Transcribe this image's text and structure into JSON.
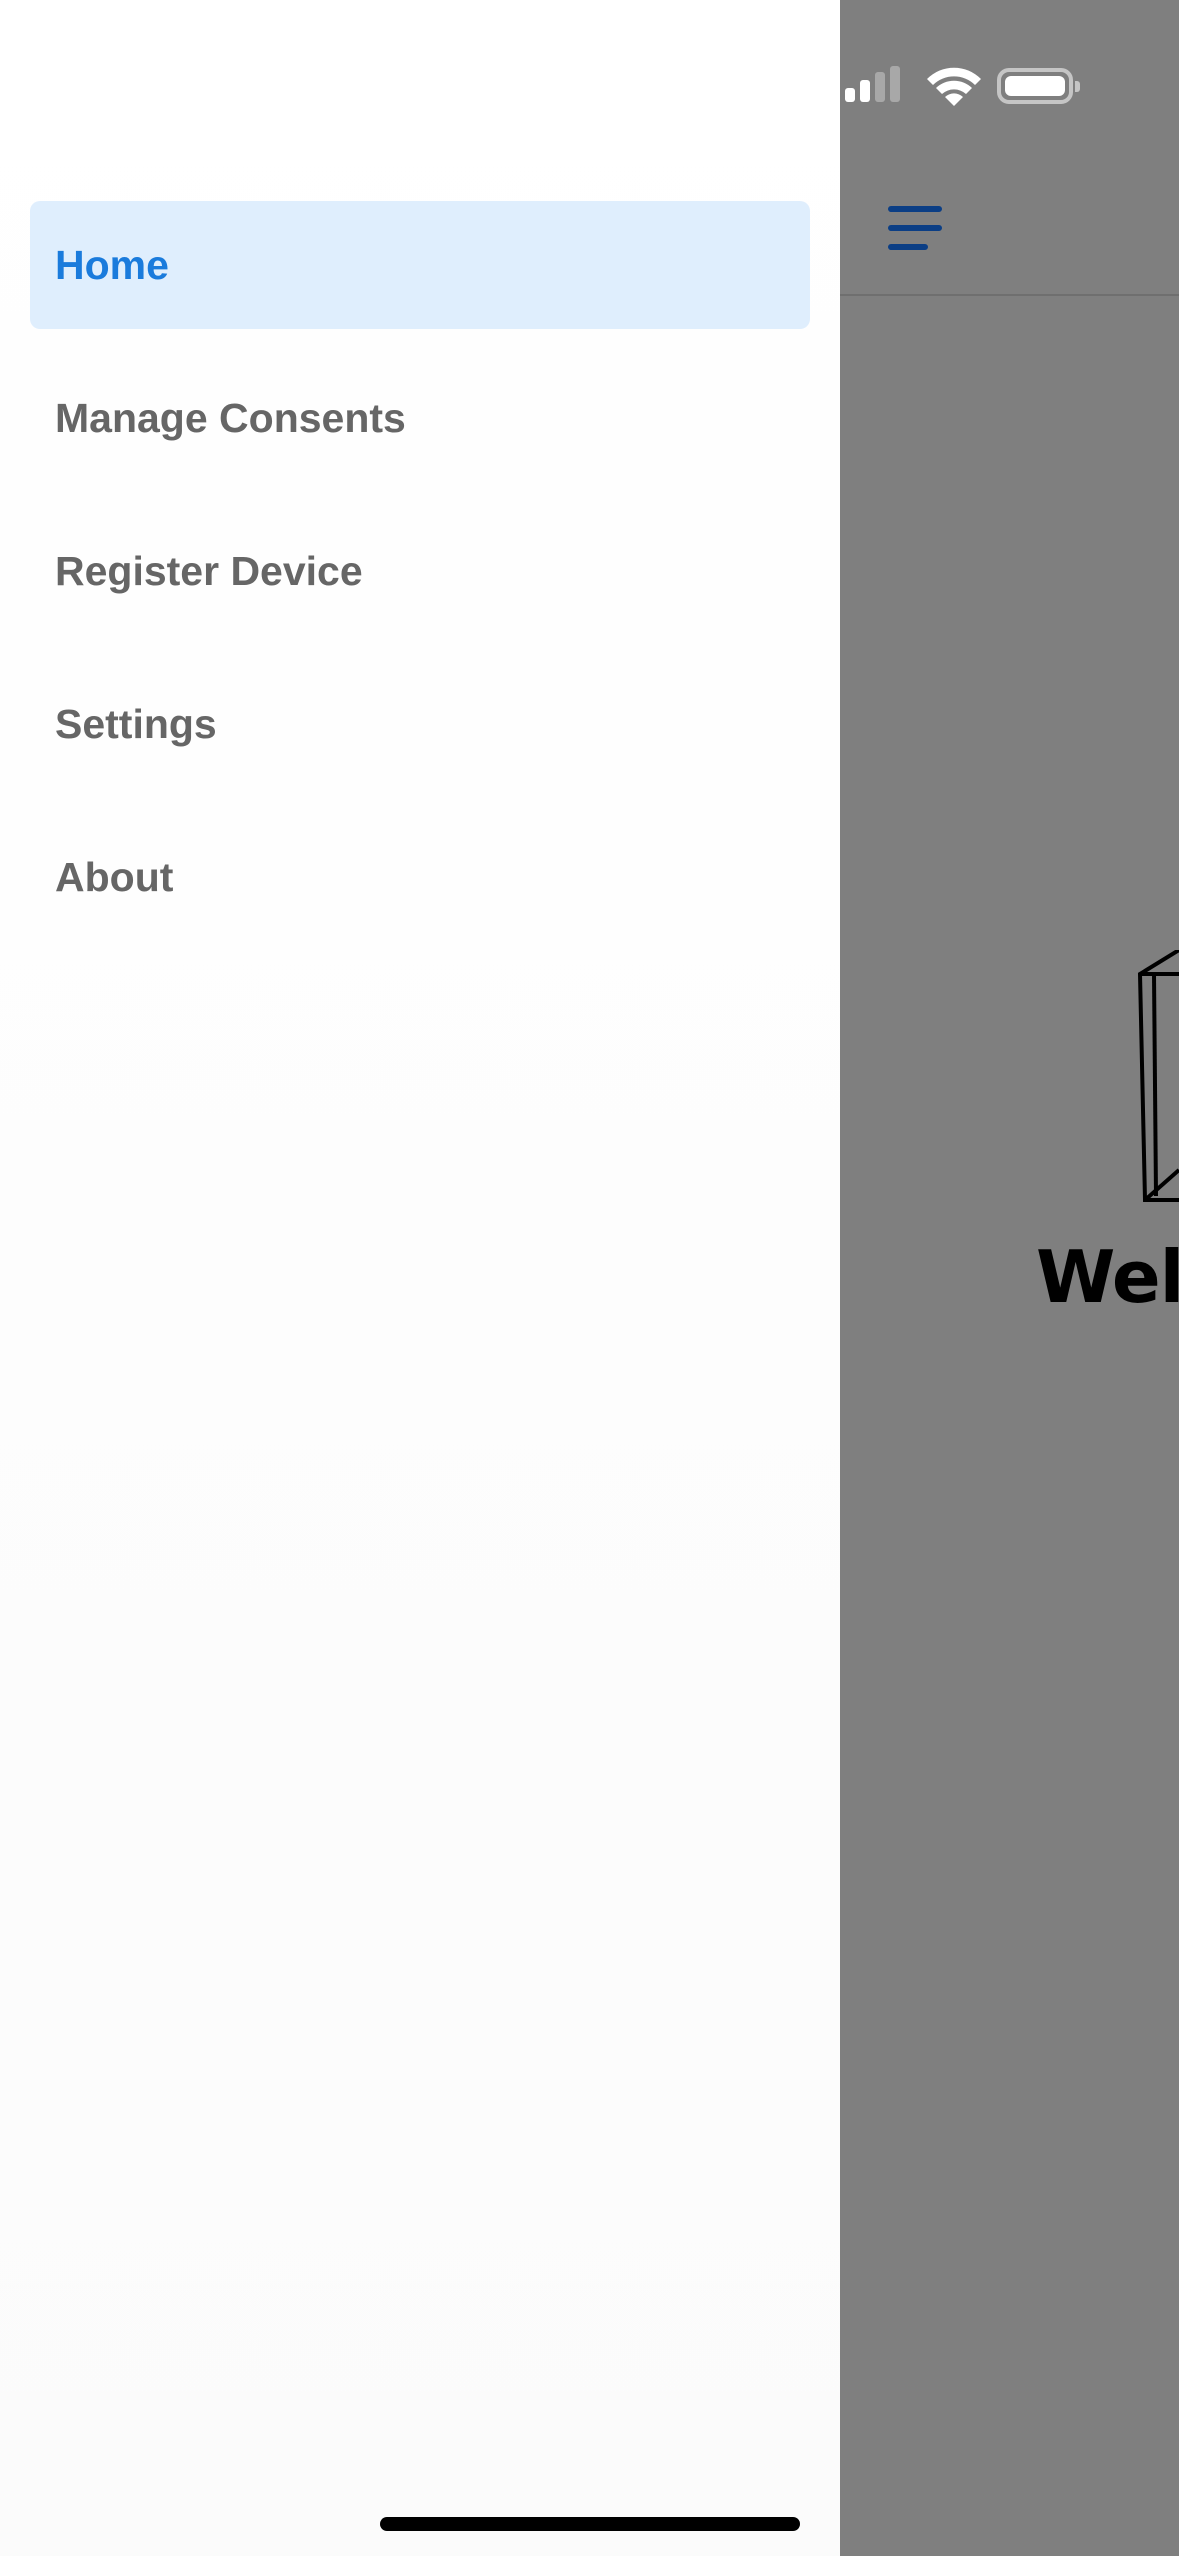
{
  "drawer": {
    "items": [
      {
        "label": "Home",
        "active": true
      },
      {
        "label": "Manage Consents",
        "active": false
      },
      {
        "label": "Register Device",
        "active": false
      },
      {
        "label": "Settings",
        "active": false
      },
      {
        "label": "About",
        "active": false
      }
    ]
  },
  "background_screen": {
    "welcome_text": "Welc",
    "menu_icon": "hamburger-menu-icon",
    "illustration_icon": "building-outline-icon"
  },
  "status_bar": {
    "icons": [
      "cellular-signal-icon",
      "wifi-icon",
      "battery-icon"
    ]
  },
  "colors": {
    "active_bg": "#dfeefd",
    "active_text": "#1a7bdc",
    "inactive_text": "#666666",
    "overlay": "#7f7f7f",
    "hamburger": "#0b3e85"
  }
}
